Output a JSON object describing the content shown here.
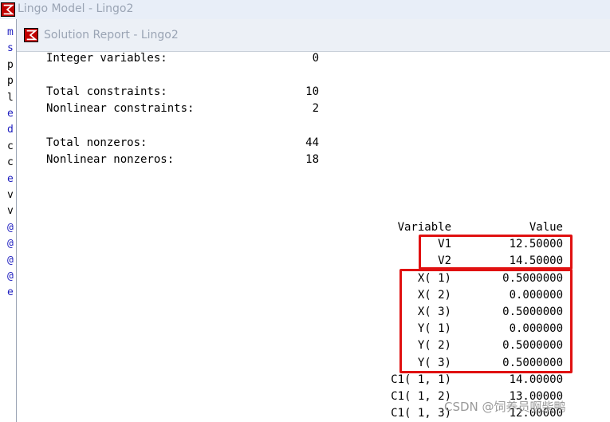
{
  "outer_window": {
    "title": "Lingo Model - Lingo2"
  },
  "model_gutter_chars": [
    {
      "ch": "m",
      "color": "#2020c0"
    },
    {
      "ch": "s",
      "color": "#2020c0"
    },
    {
      "ch": "p",
      "color": "#000000"
    },
    {
      "ch": "p",
      "color": "#000000"
    },
    {
      "ch": "l",
      "color": "#000000"
    },
    {
      "ch": "e",
      "color": "#2020c0"
    },
    {
      "ch": "d",
      "color": "#2020c0"
    },
    {
      "ch": "c",
      "color": "#000000"
    },
    {
      "ch": "c",
      "color": "#000000"
    },
    {
      "ch": "e",
      "color": "#2020c0"
    },
    {
      "ch": "v",
      "color": "#000000"
    },
    {
      "ch": "v",
      "color": "#000000"
    },
    {
      "ch": "@",
      "color": "#2020c0"
    },
    {
      "ch": "@",
      "color": "#2020c0"
    },
    {
      "ch": "@",
      "color": "#2020c0"
    },
    {
      "ch": "@",
      "color": "#2020c0"
    },
    {
      "ch": "e",
      "color": "#2020c0"
    }
  ],
  "report_window": {
    "title": "Solution Report - Lingo2"
  },
  "stats": [
    {
      "label": "Integer variables:",
      "value": "0"
    },
    {
      "label": "Total constraints:",
      "value": "10"
    },
    {
      "label": "Nonlinear constraints:",
      "value": "2"
    },
    {
      "label": "Total nonzeros:",
      "value": "44"
    },
    {
      "label": "Nonlinear nonzeros:",
      "value": "18"
    }
  ],
  "table": {
    "header_variable": "Variable",
    "header_value": "Value",
    "rows": [
      {
        "variable": "V1",
        "value": "12.50000"
      },
      {
        "variable": "V2",
        "value": "14.50000"
      },
      {
        "variable": "X( 1)",
        "value": "0.5000000"
      },
      {
        "variable": "X( 2)",
        "value": "0.000000"
      },
      {
        "variable": "X( 3)",
        "value": "0.5000000"
      },
      {
        "variable": "Y( 1)",
        "value": "0.000000"
      },
      {
        "variable": "Y( 2)",
        "value": "0.5000000"
      },
      {
        "variable": "Y( 3)",
        "value": "0.5000000"
      },
      {
        "variable": "C1( 1, 1)",
        "value": "14.00000"
      },
      {
        "variable": "C1( 1, 2)",
        "value": "13.00000"
      },
      {
        "variable": "C1( 1, 3)",
        "value": "12.00000"
      }
    ]
  },
  "watermark": "CSDN @饲养员啊柴鸭",
  "colors": {
    "highlight_box": "#e01010",
    "keyword_blue": "#2020c0"
  }
}
